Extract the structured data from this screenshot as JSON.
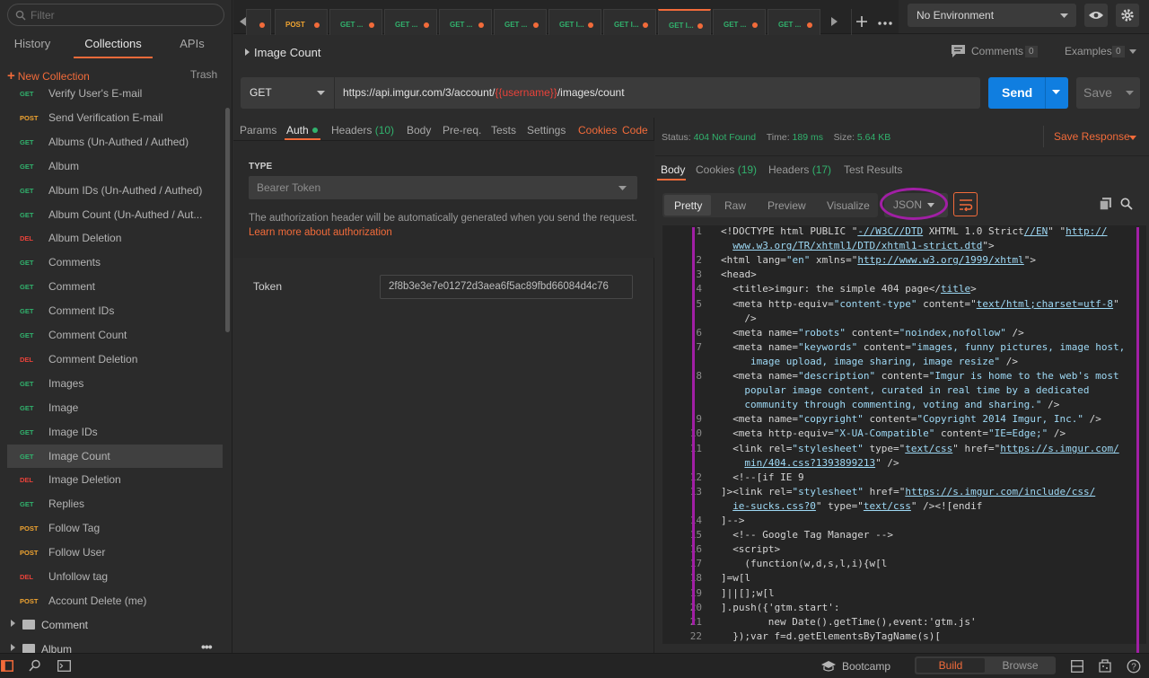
{
  "sidebar": {
    "filter_placeholder": "Filter",
    "tabs": [
      "History",
      "Collections",
      "APIs"
    ],
    "new_collection": "New Collection",
    "trash": "Trash",
    "items": [
      {
        "method": "GET",
        "name": "Verify User's E-mail"
      },
      {
        "method": "POST",
        "name": "Send Verification E-mail"
      },
      {
        "method": "GET",
        "name": "Albums (Un-Authed / Authed)"
      },
      {
        "method": "GET",
        "name": "Album"
      },
      {
        "method": "GET",
        "name": "Album IDs (Un-Authed / Authed)"
      },
      {
        "method": "GET",
        "name": "Album Count (Un-Authed / Aut..."
      },
      {
        "method": "DEL",
        "name": "Album Deletion"
      },
      {
        "method": "GET",
        "name": "Comments"
      },
      {
        "method": "GET",
        "name": "Comment"
      },
      {
        "method": "GET",
        "name": "Comment IDs"
      },
      {
        "method": "GET",
        "name": "Comment Count"
      },
      {
        "method": "DEL",
        "name": "Comment Deletion"
      },
      {
        "method": "GET",
        "name": "Images"
      },
      {
        "method": "GET",
        "name": "Image"
      },
      {
        "method": "GET",
        "name": "Image IDs"
      },
      {
        "method": "GET",
        "name": "Image Count",
        "selected": true
      },
      {
        "method": "DEL",
        "name": "Image Deletion"
      },
      {
        "method": "GET",
        "name": "Replies"
      },
      {
        "method": "POST",
        "name": "Follow Tag"
      },
      {
        "method": "POST",
        "name": "Follow User"
      },
      {
        "method": "DEL",
        "name": "Unfollow tag"
      },
      {
        "method": "POST",
        "name": "Account Delete (me)"
      }
    ],
    "folders": [
      "Comment",
      "Album"
    ]
  },
  "request_tabs": [
    {
      "method": "POST",
      "label": "POST"
    },
    {
      "method": "GET",
      "label": "GET ..."
    },
    {
      "method": "GET",
      "label": "GET ..."
    },
    {
      "method": "GET",
      "label": "GET ..."
    },
    {
      "method": "GET",
      "label": "GET ..."
    },
    {
      "method": "GET",
      "label": "GET I..."
    },
    {
      "method": "GET",
      "label": "GET I..."
    },
    {
      "method": "GET",
      "label": "GET I...",
      "active": true
    },
    {
      "method": "GET",
      "label": "GET ..."
    },
    {
      "method": "GET",
      "label": "GET ..."
    }
  ],
  "environment": "No Environment",
  "request": {
    "title": "Image Count",
    "comments_label": "Comments",
    "comments_count": "0",
    "examples_label": "Examples",
    "examples_count": "0",
    "method": "GET",
    "url_prefix": "https://api.imgur.com/3/account/",
    "url_var": "{{username}}",
    "url_suffix": "/images/count",
    "send": "Send",
    "save": "Save"
  },
  "request_nav": {
    "params": "Params",
    "auth": "Auth",
    "headers": "Headers",
    "headers_count": "(10)",
    "body": "Body",
    "prereq": "Pre-req.",
    "tests": "Tests",
    "settings": "Settings",
    "cookies": "Cookies",
    "code": "Code"
  },
  "auth": {
    "type_label": "TYPE",
    "type_value": "Bearer Token",
    "note": "The authorization header will be automatically generated when you send the request.",
    "learn_more": "Learn more about authorization",
    "token_label": "Token",
    "token_value": "2f8b3e3e7e01272d3aea6f5ac89fbd66084d4c76"
  },
  "response": {
    "status_label": "Status:",
    "status_value": "404 Not Found",
    "time_label": "Time:",
    "time_value": "189 ms",
    "size_label": "Size:",
    "size_value": "5.64 KB",
    "save_response": "Save Response",
    "tabs": {
      "body": "Body",
      "cookies": "Cookies",
      "cookies_count": "(19)",
      "headers": "Headers",
      "headers_count": "(17)",
      "test_results": "Test Results"
    },
    "views": [
      "Pretty",
      "Raw",
      "Preview",
      "Visualize"
    ],
    "format": "JSON"
  },
  "code_lines": [
    {
      "n": "1",
      "indent": 0,
      "segs": [
        [
          "t",
          "<!DOCTYPE html PUBLIC \""
        ],
        [
          "u",
          "-//W3C//DTD"
        ],
        [
          "t",
          " XHTML 1.0 Strict"
        ],
        [
          "u",
          "//EN"
        ],
        [
          "t",
          "\" \""
        ],
        [
          "u",
          "http://"
        ]
      ]
    },
    {
      "n": "",
      "indent": 2,
      "segs": [
        [
          "u",
          "www.w3.org/TR/xhtml1/DTD/xhtml1-strict.dtd"
        ],
        [
          "t",
          "\">"
        ]
      ]
    },
    {
      "n": "2",
      "indent": 0,
      "segs": [
        [
          "t",
          "<html lang="
        ],
        [
          "s",
          "\"en\""
        ],
        [
          "t",
          " xmlns=\""
        ],
        [
          "u",
          "http://www.w3.org/1999/xhtml"
        ],
        [
          "t",
          "\">"
        ]
      ]
    },
    {
      "n": "3",
      "indent": 0,
      "segs": [
        [
          "t",
          "<head>"
        ]
      ]
    },
    {
      "n": "4",
      "indent": 2,
      "segs": [
        [
          "t",
          "<title>imgur: the simple 404 page</"
        ],
        [
          "u",
          "title"
        ],
        [
          "t",
          ">"
        ]
      ]
    },
    {
      "n": "5",
      "indent": 2,
      "segs": [
        [
          "t",
          "<meta http-equiv="
        ],
        [
          "s",
          "\"content-type\""
        ],
        [
          "t",
          " content=\""
        ],
        [
          "u",
          "text/html;charset=utf-8"
        ],
        [
          "t",
          "\""
        ]
      ]
    },
    {
      "n": "",
      "indent": 4,
      "segs": [
        [
          "t",
          "/>"
        ]
      ]
    },
    {
      "n": "6",
      "indent": 2,
      "segs": [
        [
          "t",
          "<meta name="
        ],
        [
          "s",
          "\"robots\""
        ],
        [
          "t",
          " content="
        ],
        [
          "s",
          "\"noindex,nofollow\""
        ],
        [
          "t",
          " />"
        ]
      ]
    },
    {
      "n": "7",
      "indent": 2,
      "segs": [
        [
          "t",
          "<meta name="
        ],
        [
          "s",
          "\"keywords\""
        ],
        [
          "t",
          " content="
        ],
        [
          "s",
          "\"images, funny pictures, image host,"
        ]
      ]
    },
    {
      "n": "",
      "indent": 5,
      "segs": [
        [
          "s",
          "image upload, image sharing, image resize\""
        ],
        [
          "t",
          " />"
        ]
      ]
    },
    {
      "n": "8",
      "indent": 2,
      "segs": [
        [
          "t",
          "<meta name="
        ],
        [
          "s",
          "\"description\""
        ],
        [
          "t",
          " content="
        ],
        [
          "s",
          "\"Imgur is home to the web's most"
        ]
      ]
    },
    {
      "n": "",
      "indent": 4,
      "segs": [
        [
          "s",
          "popular image content, curated in real time by a dedicated"
        ]
      ]
    },
    {
      "n": "",
      "indent": 4,
      "segs": [
        [
          "s",
          "community through commenting, voting and sharing.\""
        ],
        [
          "t",
          " />"
        ]
      ]
    },
    {
      "n": "9",
      "indent": 2,
      "segs": [
        [
          "t",
          "<meta name="
        ],
        [
          "s",
          "\"copyright\""
        ],
        [
          "t",
          " content="
        ],
        [
          "s",
          "\"Copyright 2014 Imgur, Inc.\""
        ],
        [
          "t",
          " />"
        ]
      ]
    },
    {
      "n": "10",
      "indent": 2,
      "segs": [
        [
          "t",
          "<meta http-equiv="
        ],
        [
          "s",
          "\"X-UA-Compatible\""
        ],
        [
          "t",
          " content="
        ],
        [
          "s",
          "\"IE=Edge;\""
        ],
        [
          "t",
          " />"
        ]
      ]
    },
    {
      "n": "11",
      "indent": 2,
      "segs": [
        [
          "t",
          "<link rel="
        ],
        [
          "s",
          "\"stylesheet\""
        ],
        [
          "t",
          " type=\""
        ],
        [
          "u",
          "text/css"
        ],
        [
          "t",
          "\" href=\""
        ],
        [
          "u",
          "https://s.imgur.com/"
        ]
      ]
    },
    {
      "n": "",
      "indent": 4,
      "segs": [
        [
          "u",
          "min/404.css?1393899213"
        ],
        [
          "t",
          "\" />"
        ]
      ]
    },
    {
      "n": "12",
      "indent": 2,
      "segs": [
        [
          "t",
          "<!--[if IE 9"
        ]
      ]
    },
    {
      "n": "13",
      "indent": 0,
      "segs": [
        [
          "t",
          "]><link rel="
        ],
        [
          "s",
          "\"stylesheet\""
        ],
        [
          "t",
          " href=\""
        ],
        [
          "u",
          "https://s.imgur.com/include/css/"
        ]
      ]
    },
    {
      "n": "",
      "indent": 2,
      "segs": [
        [
          "u",
          "ie-sucks.css?0"
        ],
        [
          "t",
          "\" type=\""
        ],
        [
          "u",
          "text/css"
        ],
        [
          "t",
          "\" /><![endif"
        ]
      ]
    },
    {
      "n": "14",
      "indent": 0,
      "segs": [
        [
          "t",
          "]-->"
        ]
      ]
    },
    {
      "n": "15",
      "indent": 2,
      "segs": [
        [
          "t",
          "<!-- Google Tag Manager -->"
        ]
      ]
    },
    {
      "n": "16",
      "indent": 2,
      "segs": [
        [
          "t",
          "<script>"
        ]
      ]
    },
    {
      "n": "17",
      "indent": 4,
      "segs": [
        [
          "t",
          "(function(w,d,s,l,i){w[l"
        ]
      ]
    },
    {
      "n": "18",
      "indent": 0,
      "segs": [
        [
          "t",
          "]=w[l"
        ]
      ]
    },
    {
      "n": "19",
      "indent": 0,
      "segs": [
        [
          "t",
          "]||[];w[l"
        ]
      ]
    },
    {
      "n": "20",
      "indent": 0,
      "segs": [
        [
          "t",
          "].push({'gtm.start':"
        ]
      ]
    },
    {
      "n": "21",
      "indent": 8,
      "segs": [
        [
          "t",
          "new Date().getTime(),event:'gtm.js'"
        ]
      ]
    },
    {
      "n": "22",
      "indent": 2,
      "segs": [
        [
          "t",
          "});var f=d.getElementsByTagName(s)["
        ]
      ]
    }
  ],
  "bottom": {
    "bootcamp": "Bootcamp",
    "build": "Build",
    "browse": "Browse"
  },
  "colors": {
    "accent": "#f26b3a",
    "get": "#31b26d",
    "post": "#f0a431",
    "del": "#e8423a",
    "send": "#107ee0",
    "annotation": "#a11fa5"
  }
}
